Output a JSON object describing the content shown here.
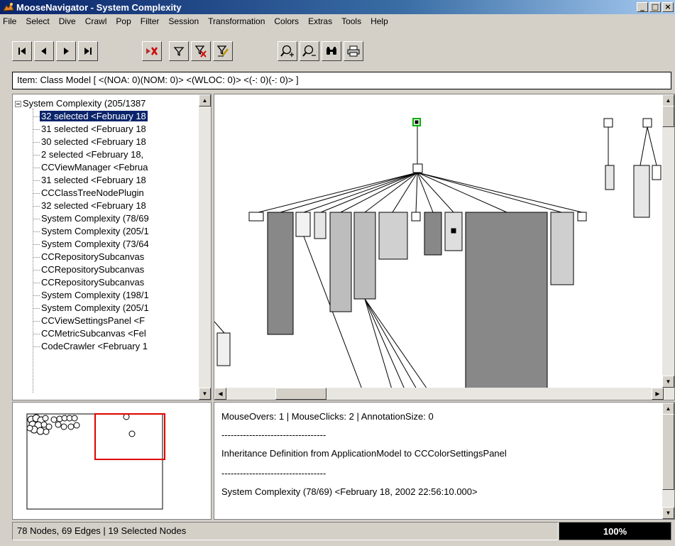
{
  "window": {
    "title": "MooseNavigator - System Complexity",
    "controls": [
      "_",
      "□",
      "×"
    ]
  },
  "menu": [
    {
      "label": "File"
    },
    {
      "label": "Select"
    },
    {
      "label": "Dive"
    },
    {
      "label": "Crawl"
    },
    {
      "label": "Pop"
    },
    {
      "label": "Filter"
    },
    {
      "label": "Session"
    },
    {
      "label": "Transformation"
    },
    {
      "label": "Colors"
    },
    {
      "label": "Extras"
    },
    {
      "label": "Tools"
    },
    {
      "label": "Help"
    }
  ],
  "toolbar": {
    "buttons": [
      "first-icon",
      "previous-icon",
      "next-icon",
      "last-icon",
      "delete-icon",
      "filter-icon",
      "filter-remove-icon",
      "filter-edit-icon",
      "zoom-in-icon",
      "zoom-out-icon",
      "binoculars-icon",
      "print-icon"
    ]
  },
  "item_bar": {
    "text": "Item: Class Model [ <(NOA: 0)(NOM: 0)> <(WLOC: 0)> <(-: 0)(-: 0)> ]"
  },
  "tree": {
    "root": "System Complexity (205/1387",
    "items": [
      {
        "label": "32 selected  <February 18",
        "selected": true
      },
      {
        "label": "31 selected  <February 18"
      },
      {
        "label": "30 selected  <February 18"
      },
      {
        "label": "2 selected  <February 18,"
      },
      {
        "label": "CCViewManager  <Februa"
      },
      {
        "label": "31 selected  <February 18"
      },
      {
        "label": "CCClassTreeNodePlugin"
      },
      {
        "label": "32 selected  <February 18"
      },
      {
        "label": "System Complexity (78/69"
      },
      {
        "label": "System Complexity (205/1"
      },
      {
        "label": "System Complexity (73/64"
      },
      {
        "label": "CCRepositorySubcanvas"
      },
      {
        "label": "CCRepositorySubcanvas"
      },
      {
        "label": "CCRepositorySubcanvas"
      },
      {
        "label": "System Complexity (198/1"
      },
      {
        "label": "System Complexity (205/1"
      },
      {
        "label": "CCViewSettingsPanel  <F"
      },
      {
        "label": "CCMetricSubcanvas  <Fel"
      },
      {
        "label": "CodeCrawler  <February 1"
      }
    ]
  },
  "info": {
    "line1": "MouseOvers: 1 | MouseClicks: 2 | AnnotationSize: 0",
    "separator1": "----------------------------------",
    "line2": "Inheritance Definition from ApplicationModel to CCColorSettingsPanel",
    "separator2": "----------------------------------",
    "line3": "System Complexity (78/69)  <February 18, 2002 22:56:10.000>"
  },
  "status": {
    "text": "78 Nodes, 69 Edges | 19 Selected Nodes",
    "zoom": "100%"
  },
  "colors": {
    "selection": "#0a246a",
    "dark_node": "#888888",
    "mid_node": "#bdbdbd",
    "light_node": "#e6e6e6",
    "viewport_frame": "#e00000",
    "focus_node": "#00b000"
  }
}
